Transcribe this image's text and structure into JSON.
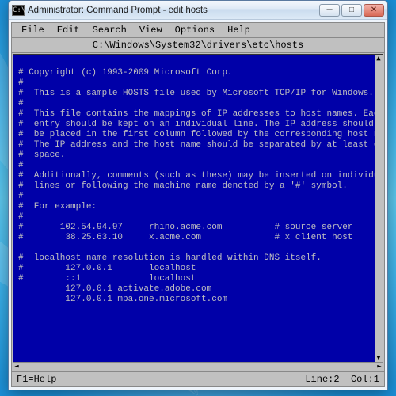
{
  "window": {
    "title": "Administrator: Command Prompt - edit  hosts",
    "icon_glyph": "C:\\"
  },
  "menubar": {
    "items": [
      "File",
      "Edit",
      "Search",
      "View",
      "Options",
      "Help"
    ]
  },
  "pathbar": "C:\\Windows\\System32\\drivers\\etc\\hosts",
  "editor_lines": [
    "# Copyright (c) 1993-2009 Microsoft Corp.",
    "#",
    "#  This is a sample HOSTS file used by Microsoft TCP/IP for Windows.",
    "#",
    "#  This file contains the mappings of IP addresses to host names. Each",
    "#  entry should be kept on an individual line. The IP address should",
    "#  be placed in the first column followed by the corresponding host name.",
    "#  The IP address and the host name should be separated by at least one",
    "#  space.",
    "#",
    "#  Additionally, comments (such as these) may be inserted on individual",
    "#  lines or following the machine name denoted by a '#' symbol.",
    "#",
    "#  For example:",
    "#",
    "#       102.54.94.97     rhino.acme.com          # source server",
    "#        38.25.63.10     x.acme.com              # x client host",
    "",
    "#  localhost name resolution is handled within DNS itself.",
    "#        127.0.0.1       localhost",
    "#        ::1             localhost",
    "         127.0.0.1 activate.adobe.com",
    "         127.0.0.1 mpa.one.microsoft.com"
  ],
  "status": {
    "help": "F1=Help",
    "line_label": "Line:",
    "line_value": "2",
    "col_label": "Col:",
    "col_value": "1"
  },
  "controls": {
    "min": "─",
    "max": "□",
    "close": "✕",
    "up": "▲",
    "down": "▼",
    "left": "◄",
    "right": "►"
  }
}
